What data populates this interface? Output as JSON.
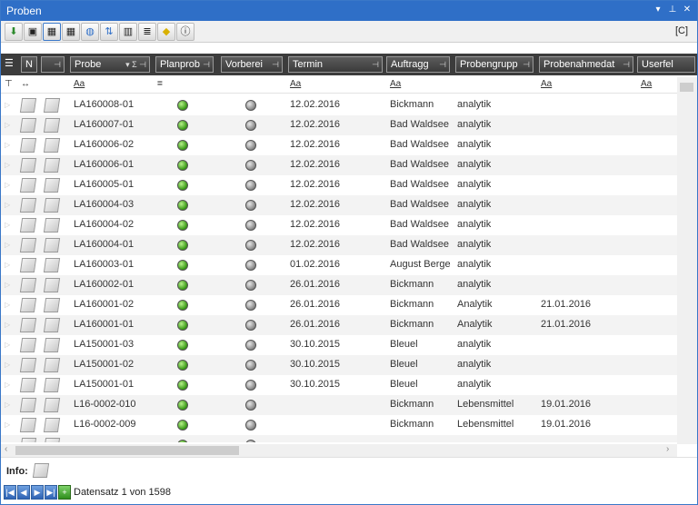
{
  "window": {
    "title": "Proben"
  },
  "toolbar": {
    "right_tag": "[C]",
    "icons": [
      "export-icon",
      "save-icon",
      "grid-select-icon",
      "grid-icon",
      "globe-icon",
      "sort-icon",
      "columns-icon",
      "report-icon",
      "note-icon",
      "info-icon"
    ]
  },
  "columns": {
    "n": "N",
    "probe": "Probe",
    "planprob": "Planprob",
    "vorberei": "Vorberei",
    "termin": "Termin",
    "auftragg": "Auftragg",
    "probengrupp": "Probengrupp",
    "probenahmedat": "Probenahmedat",
    "userfel": "Userfel"
  },
  "filters": {
    "text": "Aa",
    "eq": "=",
    "range": "↔"
  },
  "rows": [
    {
      "probe": "LA160008-01",
      "plan": "green",
      "vor": "gray",
      "termin": "12.02.2016",
      "auftragg": "Bickmann",
      "gruppe": "analytik",
      "datum": ""
    },
    {
      "probe": "LA160007-01",
      "plan": "green",
      "vor": "gray",
      "termin": "12.02.2016",
      "auftragg": "Bad Waldsee",
      "gruppe": "analytik",
      "datum": ""
    },
    {
      "probe": "LA160006-02",
      "plan": "green",
      "vor": "gray",
      "termin": "12.02.2016",
      "auftragg": "Bad Waldsee",
      "gruppe": "analytik",
      "datum": ""
    },
    {
      "probe": "LA160006-01",
      "plan": "green",
      "vor": "gray",
      "termin": "12.02.2016",
      "auftragg": "Bad Waldsee",
      "gruppe": "analytik",
      "datum": ""
    },
    {
      "probe": "LA160005-01",
      "plan": "green",
      "vor": "gray",
      "termin": "12.02.2016",
      "auftragg": "Bad Waldsee",
      "gruppe": "analytik",
      "datum": ""
    },
    {
      "probe": "LA160004-03",
      "plan": "green",
      "vor": "gray",
      "termin": "12.02.2016",
      "auftragg": "Bad Waldsee",
      "gruppe": "analytik",
      "datum": ""
    },
    {
      "probe": "LA160004-02",
      "plan": "green",
      "vor": "gray",
      "termin": "12.02.2016",
      "auftragg": "Bad Waldsee",
      "gruppe": "analytik",
      "datum": ""
    },
    {
      "probe": "LA160004-01",
      "plan": "green",
      "vor": "gray",
      "termin": "12.02.2016",
      "auftragg": "Bad Waldsee",
      "gruppe": "analytik",
      "datum": ""
    },
    {
      "probe": "LA160003-01",
      "plan": "green",
      "vor": "gray",
      "termin": "01.02.2016",
      "auftragg": "August Berge",
      "gruppe": "analytik",
      "datum": ""
    },
    {
      "probe": "LA160002-01",
      "plan": "green",
      "vor": "gray",
      "termin": "26.01.2016",
      "auftragg": "Bickmann",
      "gruppe": "analytik",
      "datum": ""
    },
    {
      "probe": "LA160001-02",
      "plan": "green",
      "vor": "gray",
      "termin": "26.01.2016",
      "auftragg": "Bickmann",
      "gruppe": "Analytik",
      "datum": "21.01.2016"
    },
    {
      "probe": "LA160001-01",
      "plan": "green",
      "vor": "gray",
      "termin": "26.01.2016",
      "auftragg": "Bickmann",
      "gruppe": "Analytik",
      "datum": "21.01.2016"
    },
    {
      "probe": "LA150001-03",
      "plan": "green",
      "vor": "gray",
      "termin": "30.10.2015",
      "auftragg": "Bleuel",
      "gruppe": "analytik",
      "datum": ""
    },
    {
      "probe": "LA150001-02",
      "plan": "green",
      "vor": "gray",
      "termin": "30.10.2015",
      "auftragg": "Bleuel",
      "gruppe": "analytik",
      "datum": ""
    },
    {
      "probe": "LA150001-01",
      "plan": "green",
      "vor": "gray",
      "termin": "30.10.2015",
      "auftragg": "Bleuel",
      "gruppe": "analytik",
      "datum": ""
    },
    {
      "probe": "L16-0002-010",
      "plan": "green",
      "vor": "gray",
      "termin": "",
      "auftragg": "Bickmann",
      "gruppe": "Lebensmittel",
      "datum": "19.01.2016"
    },
    {
      "probe": "L16-0002-009",
      "plan": "green",
      "vor": "gray",
      "termin": "",
      "auftragg": "Bickmann",
      "gruppe": "Lebensmittel",
      "datum": "19.01.2016"
    },
    {
      "probe": "",
      "plan": "green",
      "vor": "gray",
      "termin": "",
      "auftragg": "",
      "gruppe": "",
      "datum": ""
    }
  ],
  "info": {
    "label": "Info:"
  },
  "nav": {
    "record_text": "Datensatz 1 von 1598"
  }
}
